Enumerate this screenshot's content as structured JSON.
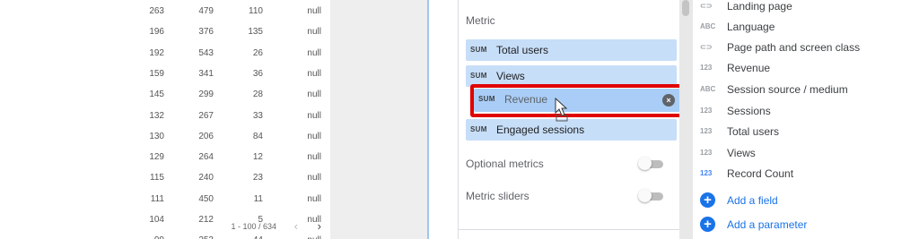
{
  "table": {
    "rows": [
      [
        "263",
        "479",
        "110",
        "null"
      ],
      [
        "196",
        "376",
        "135",
        "null"
      ],
      [
        "192",
        "543",
        "26",
        "null"
      ],
      [
        "159",
        "341",
        "36",
        "null"
      ],
      [
        "145",
        "299",
        "28",
        "null"
      ],
      [
        "132",
        "267",
        "33",
        "null"
      ],
      [
        "130",
        "206",
        "84",
        "null"
      ],
      [
        "129",
        "264",
        "12",
        "null"
      ],
      [
        "115",
        "240",
        "23",
        "null"
      ],
      [
        "111",
        "450",
        "11",
        "null"
      ],
      [
        "104",
        "212",
        "5",
        "null"
      ],
      [
        "99",
        "253",
        "44",
        "null"
      ]
    ],
    "pagination": "1 - 100 / 634",
    "prev_icon": "‹",
    "next_icon": "›"
  },
  "setup": {
    "metric_title": "Metric",
    "metrics": [
      {
        "agg": "SUM",
        "label": "Total users"
      },
      {
        "agg": "SUM",
        "label": "Views"
      },
      {
        "agg": "SUM",
        "label": "Engaged sessions"
      }
    ],
    "dragging_metric": {
      "agg": "SUM",
      "label": "Revenue",
      "close": "×"
    },
    "optional_metrics_label": "Optional metrics",
    "optional_metrics_enabled": false,
    "metric_sliders_label": "Metric sliders",
    "metric_sliders_enabled": false,
    "highlight_color": "#e00000"
  },
  "fields": {
    "items": [
      {
        "type": "LINK",
        "icon": "⊂⊃",
        "label": "Landing page"
      },
      {
        "type": "ABC",
        "icon": "ABC",
        "label": "Language"
      },
      {
        "type": "LINK",
        "icon": "⊂⊃",
        "label": "Page path and screen class"
      },
      {
        "type": "123",
        "icon": "123",
        "label": "Revenue"
      },
      {
        "type": "ABC",
        "icon": "ABC",
        "label": "Session source / medium"
      },
      {
        "type": "123",
        "icon": "123",
        "label": "Sessions"
      },
      {
        "type": "123",
        "icon": "123",
        "label": "Total users"
      },
      {
        "type": "123",
        "icon": "123",
        "label": "Views"
      },
      {
        "type": "123-blue",
        "icon": "123",
        "label": "Record Count"
      }
    ],
    "add_field": "Add a field",
    "add_parameter": "Add a parameter",
    "plus_icon": "+"
  }
}
